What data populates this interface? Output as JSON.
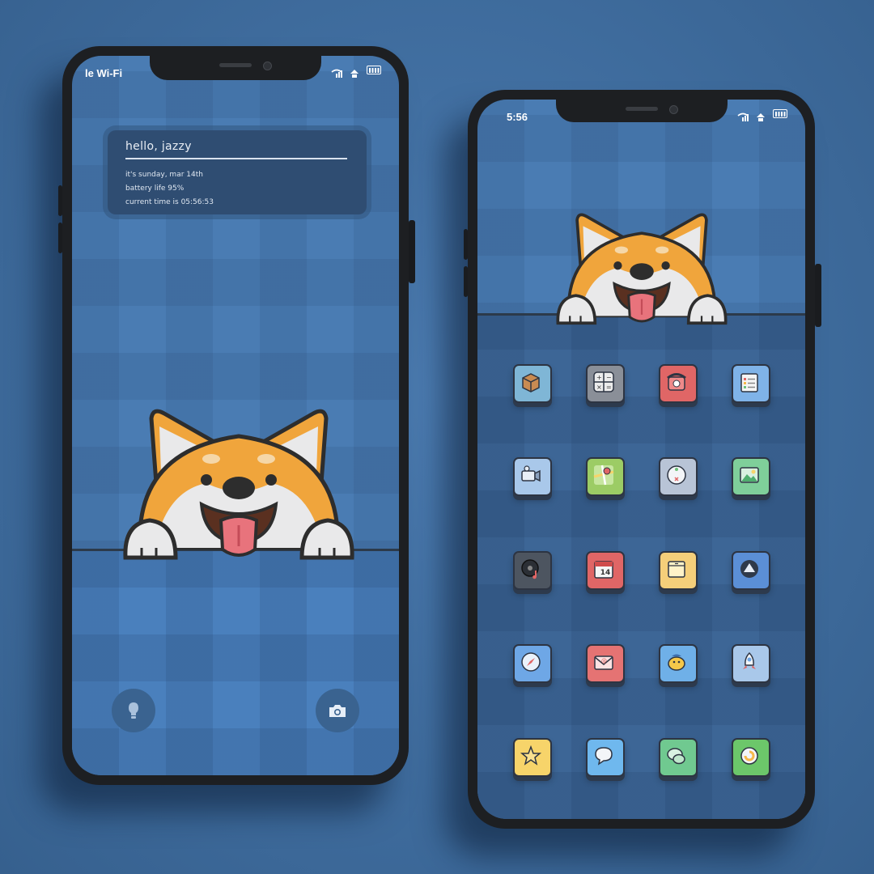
{
  "left_phone": {
    "status_carrier": "le Wi-Fi",
    "widget": {
      "title": "hello, jazzy",
      "line1": "it's sunday, mar 14th",
      "line2": "battery life 95%",
      "line3": "current time is 05:56:53"
    },
    "buttons": [
      "flashlight-icon",
      "camera-icon"
    ]
  },
  "right_phone": {
    "status_time": "5:56",
    "apps": [
      {
        "name": "files-box-icon",
        "color": "#7fb6d6"
      },
      {
        "name": "calculator-icon",
        "color": "#8a8f98"
      },
      {
        "name": "phone-icon",
        "color": "#e06666"
      },
      {
        "name": "reminders-icon",
        "color": "#7fb3e8"
      },
      {
        "name": "video-camera-icon",
        "color": "#a9c8ea"
      },
      {
        "name": "maps-icon",
        "color": "#9ccc65"
      },
      {
        "name": "clock-icon",
        "color": "#b8c4d6"
      },
      {
        "name": "photos-icon",
        "color": "#7fcf9a"
      },
      {
        "name": "music-icon",
        "color": "#4d5560"
      },
      {
        "name": "calendar-icon",
        "color": "#e06666",
        "text": "14"
      },
      {
        "name": "notes-icon",
        "color": "#f5cf7a"
      },
      {
        "name": "app-store-icon",
        "color": "#5b8fd6"
      },
      {
        "name": "safari-icon",
        "color": "#6ea7e6"
      },
      {
        "name": "mail-icon",
        "color": "#e57373"
      },
      {
        "name": "bird-icon",
        "color": "#6fb0e8"
      },
      {
        "name": "rocket-icon",
        "color": "#a9c8ea"
      },
      {
        "name": "star-icon",
        "color": "#f7d46a"
      },
      {
        "name": "messages-icon",
        "color": "#6fb8ee"
      },
      {
        "name": "wechat-icon",
        "color": "#70c990"
      },
      {
        "name": "refresh-icon",
        "color": "#6cc76a"
      }
    ]
  },
  "colors": {
    "background": "#3f6d9f",
    "screen": "#4a7cb3",
    "widget": "#2f4d72",
    "dog_orange": "#f0a53c"
  }
}
